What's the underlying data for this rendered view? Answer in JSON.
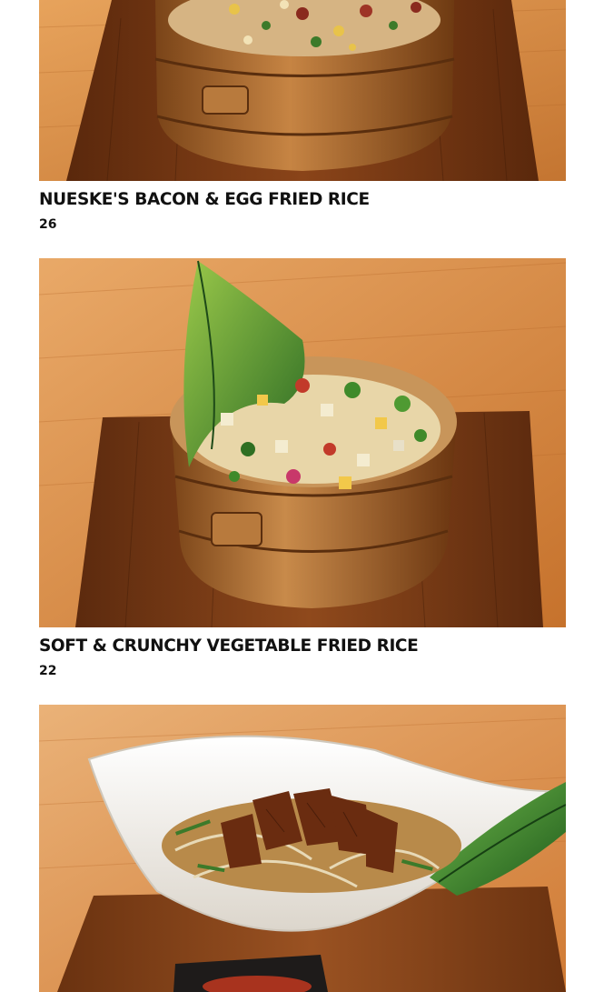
{
  "menu": {
    "items": [
      {
        "name": "NUESKE'S BACON & EGG FRIED RICE",
        "price": "26",
        "image_alt": "Bacon and egg fried rice in a wooden bucket on a wooden board"
      },
      {
        "name": "SOFT & CRUNCHY VEGETABLE FRIED RICE",
        "price": "22",
        "image_alt": "Vegetable fried rice in a wooden bucket with a banana leaf"
      },
      {
        "name": "",
        "price": "",
        "image_alt": "Sliced glazed duck over noodles in a white curved bowl"
      }
    ]
  },
  "colors": {
    "text": "#111111",
    "wood_table": "#d98b3c",
    "wood_board": "#7a3b14",
    "bucket": "#a8652e",
    "bowl": "#f4f1ec",
    "leaf": "#2f7a2a"
  }
}
